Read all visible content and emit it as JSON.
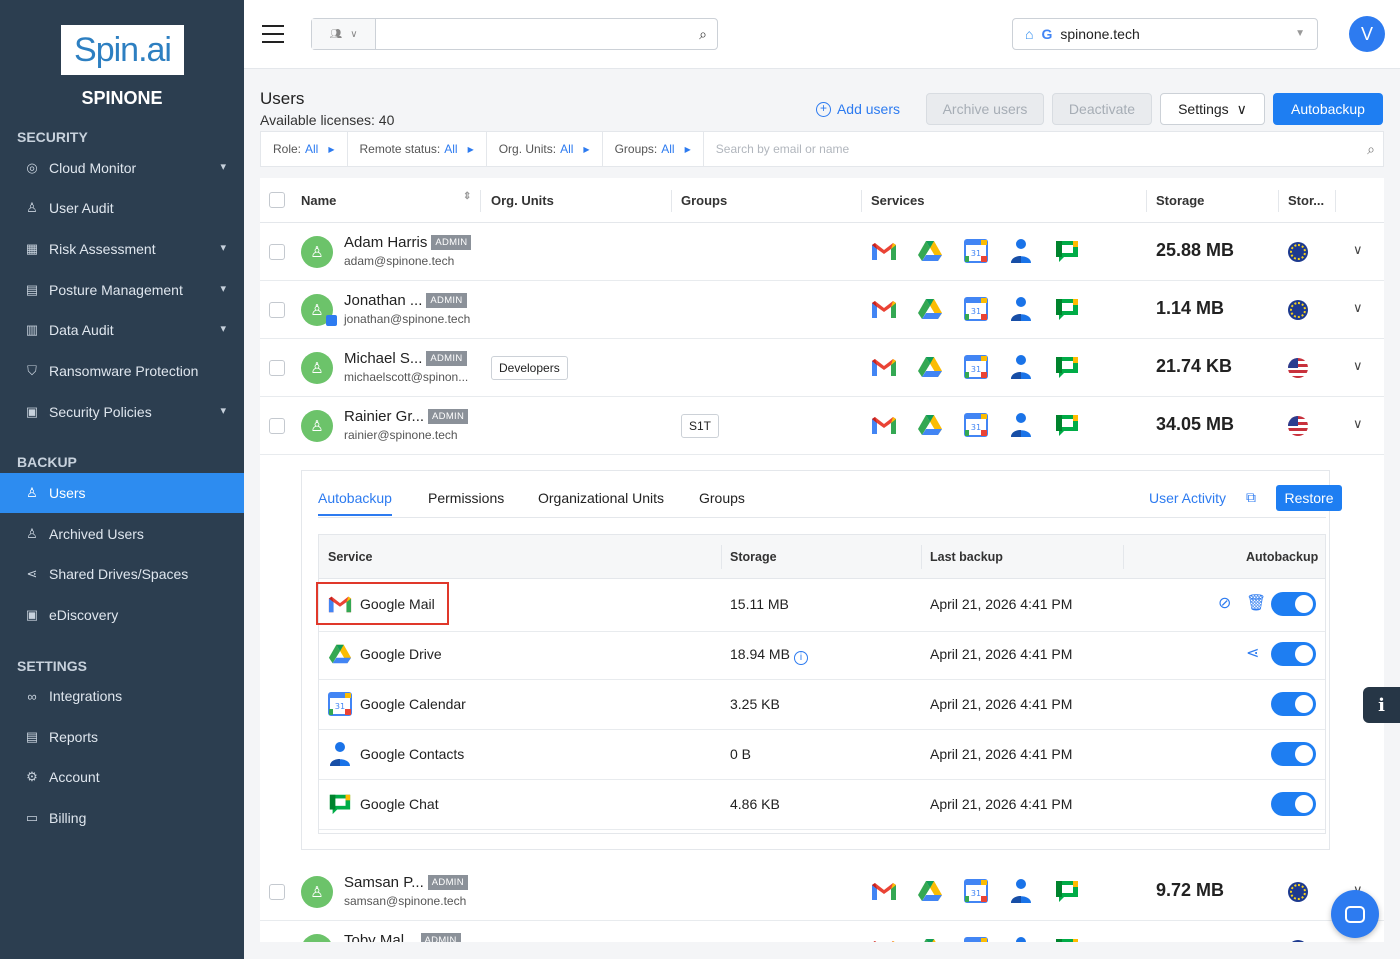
{
  "sidebar": {
    "logo": "Spin.ai",
    "brand": "SPINONE",
    "sections": {
      "security": "SECURITY",
      "backup": "BACKUP",
      "settings": "SETTINGS"
    },
    "items": [
      {
        "label": "Cloud Monitor",
        "icon": "globe-icon"
      },
      {
        "label": "User Audit",
        "icon": "user-icon"
      },
      {
        "label": "Risk Assessment",
        "icon": "grid-icon"
      },
      {
        "label": "Posture Management",
        "icon": "document-icon"
      },
      {
        "label": "Data Audit",
        "icon": "file-icon"
      },
      {
        "label": "Ransomware Protection",
        "icon": "shield-icon"
      },
      {
        "label": "Security Policies",
        "icon": "policy-icon"
      },
      {
        "label": "Users",
        "icon": "users-icon"
      },
      {
        "label": "Archived Users",
        "icon": "archived-users-icon"
      },
      {
        "label": "Shared Drives/Spaces",
        "icon": "share-icon"
      },
      {
        "label": "eDiscovery",
        "icon": "ediscovery-icon"
      },
      {
        "label": "Integrations",
        "icon": "link-icon"
      },
      {
        "label": "Reports",
        "icon": "report-icon"
      },
      {
        "label": "Account",
        "icon": "gear-icon"
      },
      {
        "label": "Billing",
        "icon": "card-icon"
      }
    ]
  },
  "topbar": {
    "domain": "spinone.tech",
    "avatar_letter": "V"
  },
  "page": {
    "title": "Users",
    "licenses": "Available licenses: 40",
    "add_users": "Add users",
    "archive_users": "Archive users",
    "deactivate": "Deactivate",
    "settings": "Settings",
    "autobackup": "Autobackup"
  },
  "filters": {
    "role_label": "Role:",
    "role_value": "All",
    "remote_label": "Remote status:",
    "remote_value": "All",
    "org_label": "Org. Units:",
    "org_value": "All",
    "groups_label": "Groups:",
    "groups_value": "All",
    "search_placeholder": "Search by email or name"
  },
  "table": {
    "headers": {
      "name": "Name",
      "org": "Org. Units",
      "groups": "Groups",
      "services": "Services",
      "storage": "Storage",
      "region": "Stor..."
    },
    "rows": [
      {
        "name": "Adam Harris",
        "badge": "ADMIN",
        "email": "adam@spinone.tech",
        "group": "",
        "org": "",
        "storage": "25.88 MB",
        "region": "eu"
      },
      {
        "name": "Jonathan ...",
        "badge": "ADMIN",
        "email": "jonathan@spinone.tech",
        "group": "",
        "org": "",
        "storage": "1.14 MB",
        "region": "eu"
      },
      {
        "name": "Michael S...",
        "badge": "ADMIN",
        "email": "michaelscott@spinon...",
        "group": "",
        "org": "Developers",
        "storage": "21.74 KB",
        "region": "us"
      },
      {
        "name": "Rainier Gr...",
        "badge": "ADMIN",
        "email": "rainier@spinone.tech",
        "group": "S1T",
        "org": "",
        "storage": "34.05 MB",
        "region": "us"
      },
      {
        "name": "Samsan P...",
        "badge": "ADMIN",
        "email": "samsan@spinone.tech",
        "group": "",
        "org": "",
        "storage": "9.72 MB",
        "region": "eu"
      },
      {
        "name": "Toby Mal...",
        "badge": "ADMIN",
        "email": "",
        "group": "",
        "org": "",
        "storage": "",
        "region": "eu"
      }
    ]
  },
  "detail": {
    "tabs": [
      "Autobackup",
      "Permissions",
      "Organizational Units",
      "Groups"
    ],
    "user_activity": "User Activity",
    "restore": "Restore",
    "headers": {
      "service": "Service",
      "storage": "Storage",
      "last": "Last backup",
      "autobackup": "Autobackup"
    },
    "services": [
      {
        "name": "Google Mail",
        "storage": "15.11 MB",
        "last": "April 21, 2026 4:41 PM",
        "icon": "gmail-icon",
        "enabled": true
      },
      {
        "name": "Google Drive",
        "storage": "18.94 MB",
        "last": "April 21, 2026 4:41 PM",
        "icon": "drive-icon",
        "enabled": true
      },
      {
        "name": "Google Calendar",
        "storage": "3.25 KB",
        "last": "April 21, 2026 4:41 PM",
        "icon": "calendar-icon",
        "enabled": true
      },
      {
        "name": "Google Contacts",
        "storage": "0 B",
        "last": "April 21, 2026 4:41 PM",
        "icon": "contacts-icon",
        "enabled": true
      },
      {
        "name": "Google Chat",
        "storage": "4.86 KB",
        "last": "April 21, 2026 4:41 PM",
        "icon": "chat-icon",
        "enabled": true
      }
    ]
  }
}
